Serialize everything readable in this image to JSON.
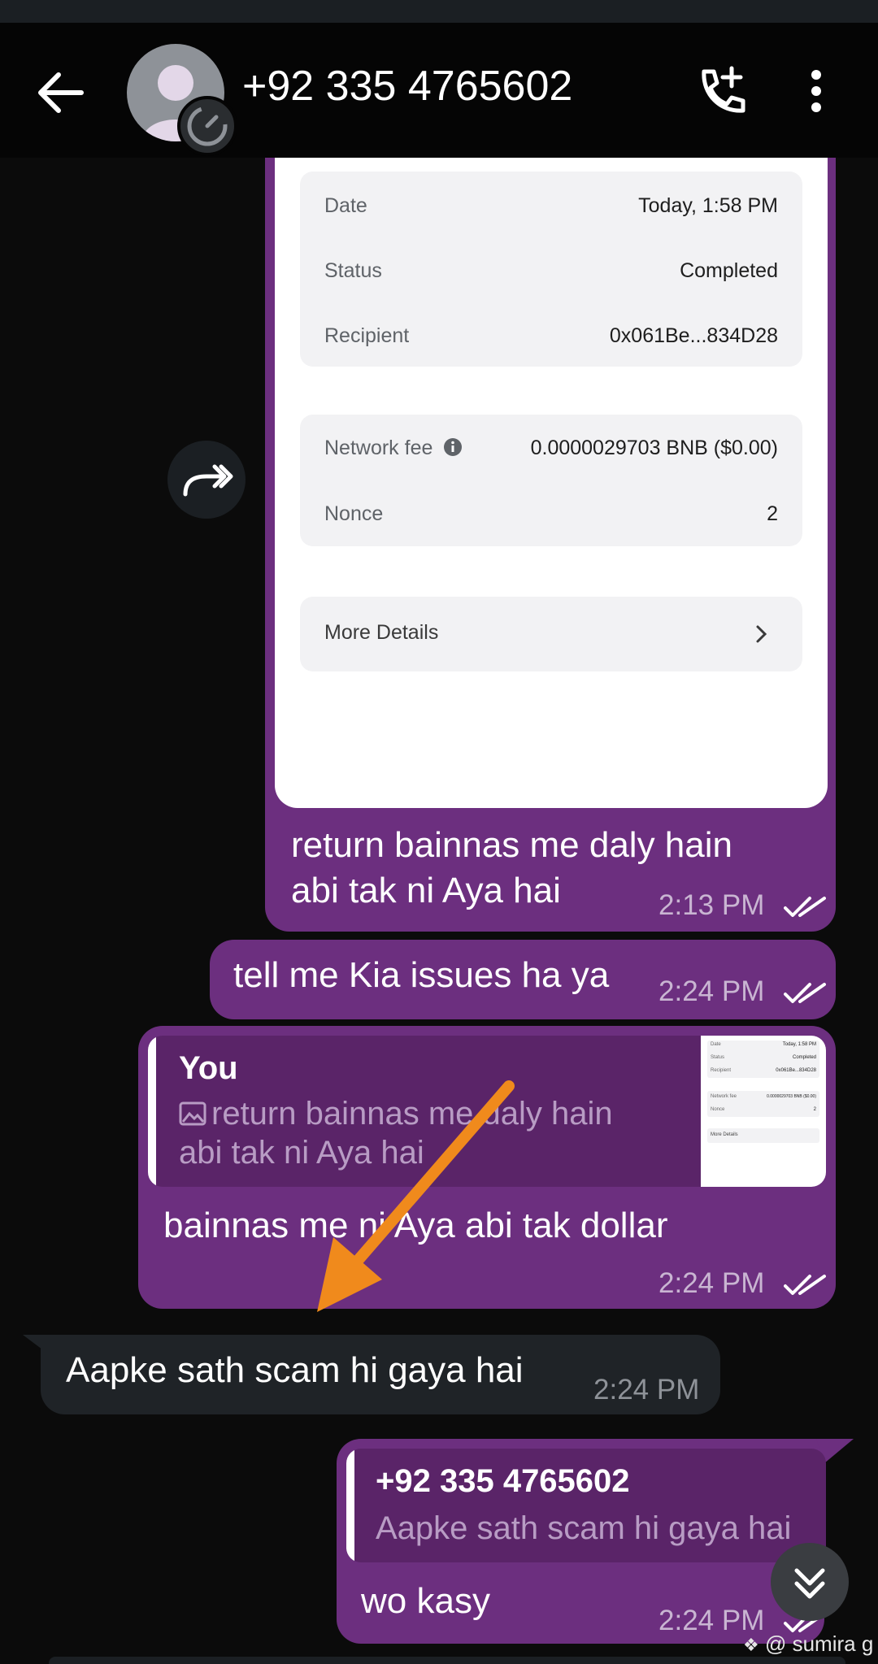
{
  "header": {
    "contact": "+92 335 4765602",
    "icons": [
      "back-arrow-icon",
      "avatar-icon",
      "status-timer-icon",
      "add-call-icon",
      "more-vertical-icon"
    ]
  },
  "receipt": {
    "rows1": [
      {
        "label": "Date",
        "value": "Today, 1:58 PM"
      },
      {
        "label": "Status",
        "value": "Completed"
      },
      {
        "label": "Recipient",
        "value": "0x061Be...834D28"
      }
    ],
    "rows2": [
      {
        "label": "Network fee",
        "value": "0.0000029703 BNB ($0.00)"
      },
      {
        "label": "Nonce",
        "value": "2"
      }
    ],
    "more_details": "More Details"
  },
  "messages": {
    "m1": {
      "line1": "return bainnas me daly hain",
      "line2": "abi tak ni Aya hai",
      "time": "2:13 PM"
    },
    "m2": {
      "text": "tell me Kia issues ha ya",
      "time": "2:24 PM"
    },
    "m3": {
      "quote_author": "You",
      "quote_line1": "return bainnas me daly hain",
      "quote_line2": "abi tak ni Aya hai",
      "text": "bainnas me ni Aya abi tak dollar",
      "time": "2:24 PM"
    },
    "m4": {
      "text": "Aapke sath scam hi gaya hai",
      "time": "2:24 PM"
    },
    "m5": {
      "quote_author": "+92 335 4765602",
      "quote_text": "Aapke sath scam hi gaya hai",
      "text": "wo kasy",
      "time": "2:24 PM"
    }
  },
  "thumb": {
    "date_label": "Date",
    "date_value": "Today, 1:58 PM",
    "status_label": "Status",
    "status_value": "Completed",
    "recipient_label": "Recipient",
    "recipient_value": "0x061Be...834D28",
    "fee_label": "Network fee",
    "fee_value": "0.0000029703 BNB ($0.00)",
    "nonce_label": "Nonce",
    "nonce_value": "2",
    "more": "More Details"
  },
  "watermark": "@ sumira g",
  "colors": {
    "outgoing": "#6c2f7f",
    "incoming": "#1f2327",
    "annotation_arrow": "#f08a1c"
  }
}
